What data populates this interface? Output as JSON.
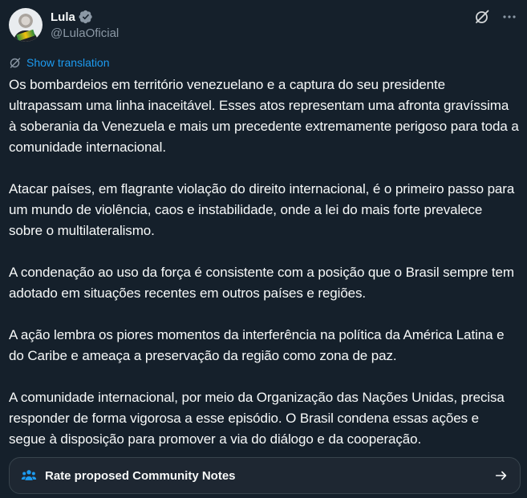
{
  "author": {
    "display_name": "Lula",
    "handle": "@LulaOficial",
    "verified": true
  },
  "icons": {
    "verified": "verified-badge-icon",
    "grok": "grok-icon",
    "more": "more-icon",
    "translate": "translate-icon",
    "community_notes": "people-icon",
    "arrow": "arrow-right-icon"
  },
  "translation": {
    "label": "Show translation"
  },
  "body": {
    "paragraphs": [
      "Os bombardeios em território venezuelano e a captura do seu presidente ultrapassam uma linha inaceitável. Esses atos representam uma afronta gravíssima à soberania da Venezuela e mais um precedente extremamente perigoso para toda a comunidade internacional.",
      "Atacar países, em flagrante violação do direito internacional, é o primeiro passo para um mundo de violência, caos e instabilidade, onde a lei do mais forte prevalece sobre o multilateralismo.",
      "A condenação ao uso da força é consistente com a posição que o Brasil sempre tem adotado em situações recentes em outros países e regiões.",
      "A ação lembra os piores momentos da interferência na política da América Latina e do Caribe e ameaça a preservação da região como zona de paz.",
      "A comunidade internacional, por meio da Organização das Nações Unidas, precisa responder de forma vigorosa a esse episódio. O Brasil condena essas ações e segue à disposição para promover a via do diálogo e da cooperação."
    ]
  },
  "community_notes": {
    "label": "Rate proposed Community Notes"
  },
  "colors": {
    "background": "#15202b",
    "text": "#f7f9f9",
    "secondary_text": "#8b98a5",
    "link": "#1d9bf0",
    "border": "#38444d"
  }
}
